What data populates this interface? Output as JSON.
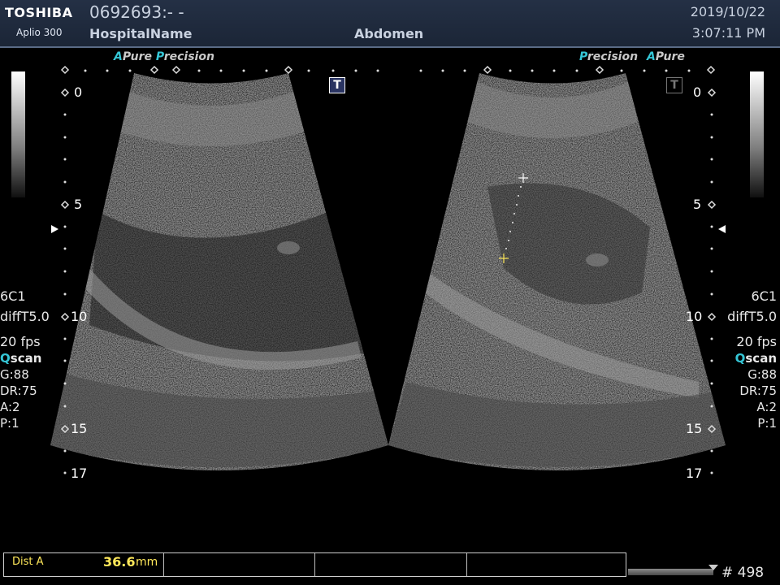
{
  "header": {
    "brand": "TOSHIBA",
    "model": "Aplio 300",
    "patient_id": "0692693:- -",
    "hospital": "HospitalName",
    "exam": "Abdomen",
    "date": "2019/10/22",
    "time": "3:07:11 PM"
  },
  "left_image": {
    "label_a": "A",
    "label_pure": "Pure",
    "label_p": "P",
    "label_precision": "recision",
    "t_button": "T",
    "depth_0": "0",
    "depth_5": "5",
    "depth_10": "10",
    "depth_15": "15",
    "depth_17": "17"
  },
  "right_image": {
    "label_p": "P",
    "label_precision": "recision",
    "label_a": "A",
    "label_pure": "Pure",
    "t_button": "T",
    "depth_0": "0",
    "depth_5": "5",
    "depth_10": "10",
    "depth_15": "15",
    "depth_17": "17"
  },
  "left_params": {
    "probe": "6C1",
    "mode": "diffT5.0",
    "fps": "20 fps",
    "qscan_q": "Q",
    "qscan_rest": "scan",
    "gain": "G:88",
    "dr": "DR:75",
    "a": "A:2",
    "p": "P:1"
  },
  "right_params": {
    "probe": "6C1",
    "mode": "diffT5.0",
    "fps": "20 fps",
    "qscan_q": "Q",
    "qscan_rest": "scan",
    "gain": "G:88",
    "dr": "DR:75",
    "a": "A:2",
    "p": "P:1"
  },
  "measurement": {
    "label": "Dist A",
    "value": "36.6",
    "unit": "mm"
  },
  "cine": {
    "frame": "# 498"
  },
  "colors": {
    "accent": "#35c6d6",
    "measure": "#ffe85a",
    "header_bg": "#1b2536"
  }
}
